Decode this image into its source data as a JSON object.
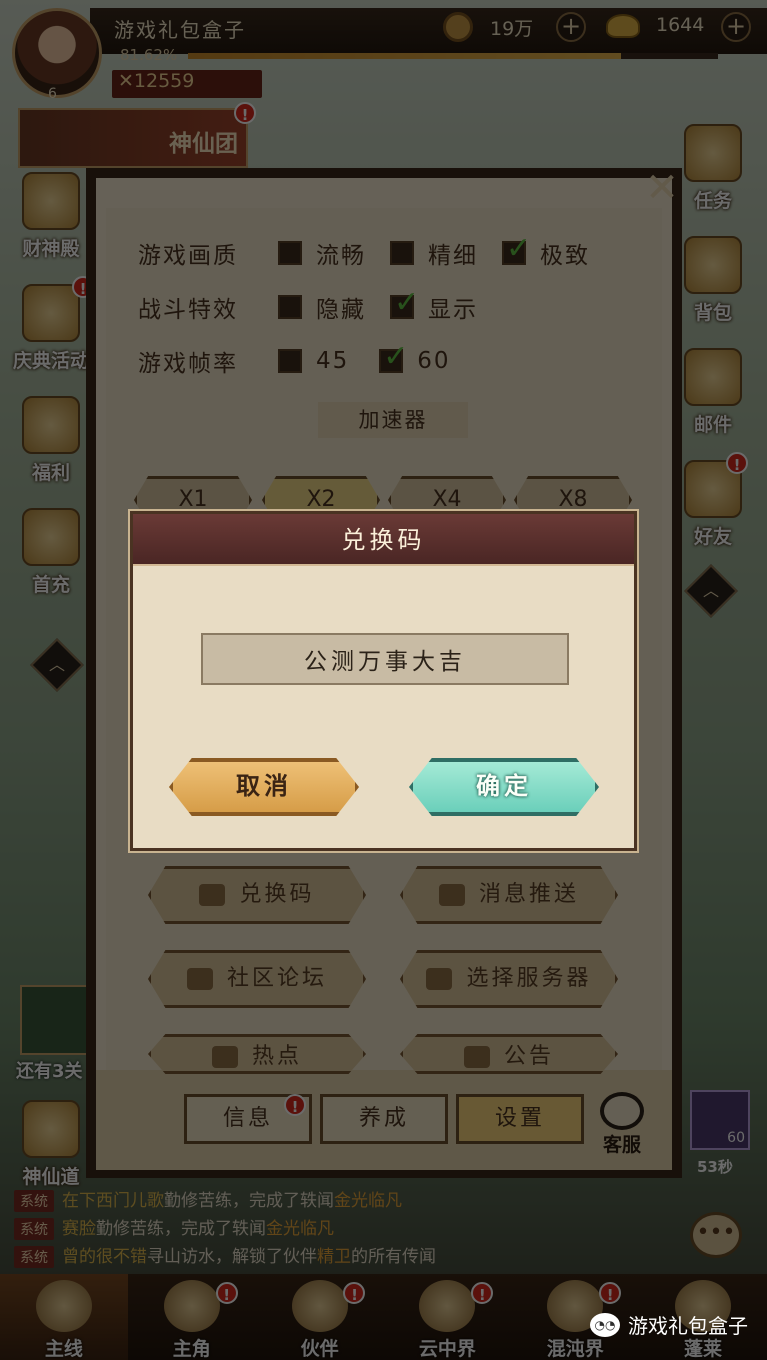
{
  "player": {
    "name": "游戏礼包盒子",
    "level": "6",
    "exp_percent": "81.62%",
    "exp_fraction": 0.8162,
    "power": "12559"
  },
  "currency": {
    "coins": "19万",
    "ingots": "1644"
  },
  "left_menu": {
    "team": "神仙团",
    "items": [
      "财神殿",
      "庆典活动",
      "福利",
      "首充"
    ],
    "quest_progress": "还有3关",
    "road": "神仙道"
  },
  "right_menu": {
    "items": [
      "任务",
      "背包",
      "邮件",
      "好友"
    ],
    "timer": "53秒",
    "puzzle_count": "60"
  },
  "settings": {
    "rows": [
      {
        "title": "游戏画质",
        "options": [
          {
            "label": "流畅",
            "checked": false
          },
          {
            "label": "精细",
            "checked": false
          },
          {
            "label": "极致",
            "checked": true
          }
        ]
      },
      {
        "title": "战斗特效",
        "options": [
          {
            "label": "隐藏",
            "checked": false
          },
          {
            "label": "显示",
            "checked": true
          }
        ]
      },
      {
        "title": "游戏帧率",
        "options": [
          {
            "label": "45",
            "checked": false
          },
          {
            "label": "60",
            "checked": true
          }
        ]
      }
    ],
    "accelerator_title": "加速器",
    "speeds": [
      "X1",
      "X2",
      "X4",
      "X8"
    ],
    "menu_buttons": [
      "兑换码",
      "消息推送",
      "社区论坛",
      "选择服务器",
      "热点",
      "公告"
    ],
    "tabs": [
      "信息",
      "养成",
      "设置"
    ],
    "service": "客服"
  },
  "dialog": {
    "title": "兑换码",
    "code_value": "公测万事大吉",
    "cancel": "取消",
    "confirm": "确定"
  },
  "chat": [
    {
      "tag": "系统",
      "name": "在下西门儿歌",
      "text": "勤修苦练，完成了轶闻",
      "highlight": "金光临凡"
    },
    {
      "tag": "系统",
      "name": "赛脸",
      "text": "勤修苦练，完成了轶闻",
      "highlight": "金光临凡"
    },
    {
      "tag": "系统",
      "name": "曾的很不错",
      "text": "寻山访水，解锁了伙伴",
      "highlight": "精卫",
      "suffix": "的所有传闻"
    }
  ],
  "bottom_nav": [
    "主线",
    "主角",
    "伙伴",
    "云中界",
    "混沌界",
    "蓬莱"
  ],
  "watermark": "游戏礼包盒子",
  "colors": {
    "confirm_button": "#66cdb8",
    "cancel_button": "#d49a44",
    "dialog_header": "#5a302d"
  }
}
